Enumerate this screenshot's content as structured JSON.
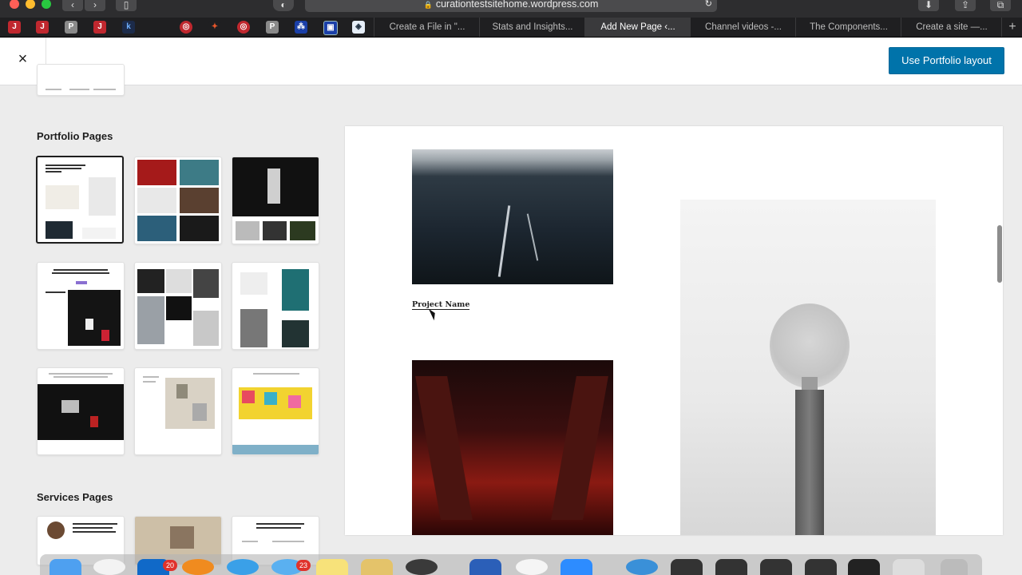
{
  "browser": {
    "url": "curationtestsitehome.wordpress.com",
    "tabs": [
      {
        "label": "Create a File in \"..."
      },
      {
        "label": "Stats and Insights..."
      },
      {
        "label": "Add New Page ‹..."
      },
      {
        "label": "Channel videos -..."
      },
      {
        "label": "The Components..."
      },
      {
        "label": "Create a site —..."
      }
    ],
    "active_tab": 2
  },
  "editor": {
    "close_label": "×",
    "use_layout_label": "Use Portfolio layout"
  },
  "sidebar": {
    "portfolio_title": "Portfolio Pages",
    "services_title": "Services Pages"
  },
  "preview": {
    "project_name": "Project Name"
  },
  "dock": {
    "badges": {
      "outlook": "20",
      "messages": "23"
    }
  },
  "colors": {
    "accent": "#0073aa",
    "chrome": "#2d2d2f",
    "canvas": "#ececec"
  }
}
